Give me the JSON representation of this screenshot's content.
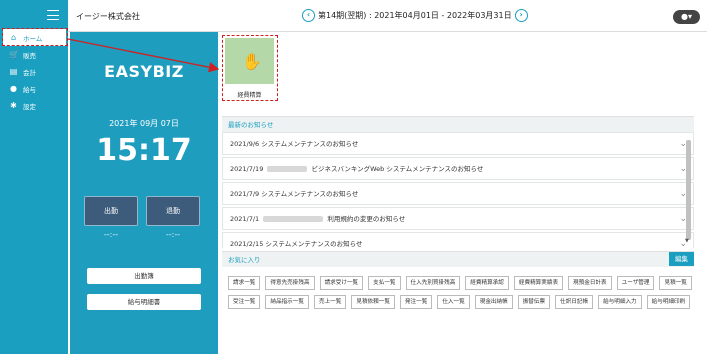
{
  "header": {
    "company": "イージー株式会社",
    "period": "第14期(翌期) : 2021年04月01日 - 2022年03月31日",
    "user_caret": "▾"
  },
  "sidebar": {
    "items": [
      {
        "label": "ホーム",
        "icon": "home-icon"
      },
      {
        "label": "販売",
        "icon": "cart-icon"
      },
      {
        "label": "会計",
        "icon": "document-icon"
      },
      {
        "label": "給与",
        "icon": "money-bag-icon"
      },
      {
        "label": "設定",
        "icon": "gear-icon"
      }
    ]
  },
  "panel": {
    "brand": "EASYBIZ",
    "date": "2021年 09月 07日",
    "time": "15:17",
    "clock_in": "出勤",
    "clock_out": "退勤",
    "clock_in_time": "--:--",
    "clock_out_time": "--:--",
    "attendance": "出勤簿",
    "payslip": "給与明細書"
  },
  "tile": {
    "label": "経費精算",
    "icon": "hand-coin-icon"
  },
  "news": {
    "heading": "最新のお知らせ",
    "items": [
      {
        "date": "2021/9/6",
        "text": "システムメンテナンスのお知らせ",
        "redacted": false
      },
      {
        "date": "2021/7/19",
        "text": "ビジネスバンキングWeb システムメンテナンスのお知らせ",
        "redacted": true
      },
      {
        "date": "2021/7/9",
        "text": "システムメンテナンスのお知らせ",
        "redacted": false
      },
      {
        "date": "2021/7/1",
        "text": "利用規約の変更のお知らせ",
        "redacted": true
      },
      {
        "date": "2021/2/15",
        "text": "システムメンテナンスのお知らせ",
        "redacted": false
      }
    ]
  },
  "favorites": {
    "heading": "お気に入り",
    "edit": "編集",
    "items": [
      "請求一覧",
      "得意先売掛残高",
      "請求受け一覧",
      "支払一覧",
      "仕入先別買掛残高",
      "経費精算承認",
      "経費精算実績表",
      "現預金日計表",
      "ユーザ管理",
      "見積一覧",
      "受注一覧",
      "納品指示一覧",
      "売上一覧",
      "見積依頼一覧",
      "発注一覧",
      "仕入一覧",
      "現金出納帳",
      "振替伝票",
      "仕訳日記帳",
      "給与明細入力",
      "給与明細印刷"
    ]
  },
  "colors": {
    "accent": "#1a9fc0",
    "highlight": "#cc1f1f",
    "tile": "#b5d8a8"
  }
}
